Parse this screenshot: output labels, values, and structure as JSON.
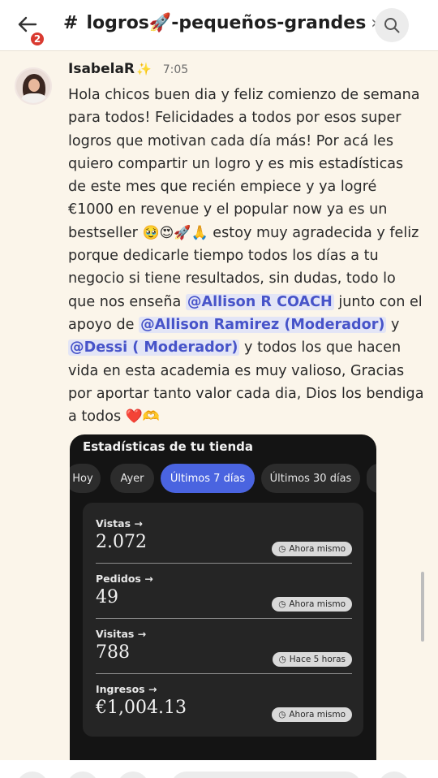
{
  "header": {
    "back_badge": "2",
    "channel_hash": "#",
    "channel_name": "logros🚀-pequeños-grandes",
    "chevron": "›",
    "icons": {
      "back": "back-arrow-icon",
      "search": "search-icon"
    }
  },
  "message": {
    "author": "IsabelaR",
    "author_sparkle": "✨",
    "time": "7:05",
    "text_1": "Hola chicos buen dia y feliz comienzo de semana para todos! Felicidades a todos por esos super logros que motivan cada día más! Por acá les quiero compartir un logro y es mis estadísticas de este mes que recién empiece y ya logré €1000 en revenue y el popular now ya es un bestseller ",
    "emojis_1": "🥹😍🚀🙏",
    "text_2": " estoy muy agradecida y feliz porque dedicarle tiempo todos los días a tu negocio si tiene resultados, sin dudas, todo lo que nos enseña ",
    "mention_1": "@Allison R COACH",
    "text_3": " junto con el apoyo de ",
    "mention_2": "@Allison Ramirez (Moderador)",
    "text_4": " y ",
    "mention_3": "@Dessi ( Moderador)",
    "text_5": " y todos los que hacen vida en esta academia es muy valioso, Gracias por aportar tanto valor cada dia, Dios los bendiga a todos ",
    "emojis_2": "❤️🫶"
  },
  "screenshot": {
    "title": "Estadísticas de tu tienda",
    "tabs": [
      {
        "label": "Hoy",
        "active": false
      },
      {
        "label": "Ayer",
        "active": false
      },
      {
        "label": "Últimos 7 días",
        "active": true
      },
      {
        "label": "Últimos 30 días",
        "active": false
      }
    ],
    "stats": [
      {
        "label": "Vistas →",
        "value": "2.072",
        "badge": "Ahora mismo"
      },
      {
        "label": "Pedidos →",
        "value": "49",
        "badge": "Ahora mismo"
      },
      {
        "label": "Visitas →",
        "value": "788",
        "badge": "Hace 5 horas"
      },
      {
        "label": "Ingresos →",
        "value": "€1,004.13",
        "badge": "Ahora mismo"
      }
    ],
    "badge_icon": "clock-icon",
    "accent_color": "#4a64e0"
  }
}
